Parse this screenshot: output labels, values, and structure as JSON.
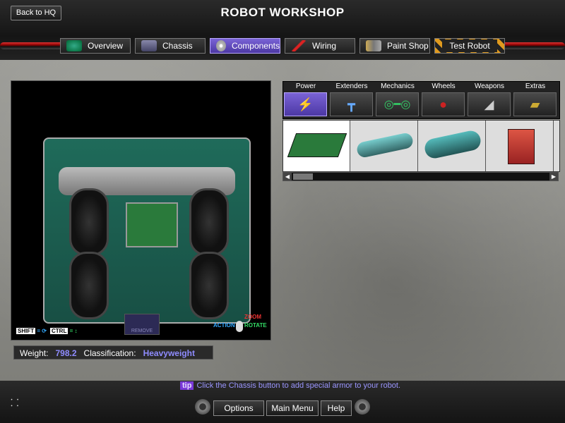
{
  "header": {
    "title": "ROBOT WORKSHOP",
    "back_label": "Back to HQ"
  },
  "tabs": [
    {
      "label": "Overview",
      "icon": "globe-icon"
    },
    {
      "label": "Chassis",
      "icon": "chassis-icon"
    },
    {
      "label": "Components",
      "icon": "gear-icon",
      "active": true
    },
    {
      "label": "Wiring",
      "icon": "wire-icon"
    },
    {
      "label": "Paint Shop",
      "icon": "paint-icon"
    },
    {
      "label": "Test Robot",
      "icon": "hazard-icon"
    }
  ],
  "viewport": {
    "shift_hint": "SHIFT",
    "ctrl_hint": "CTRL",
    "remove_label": "REMOVE",
    "action_label": "ACTION",
    "zoom_label": "ZOOM",
    "rotate_label": "ROTATE"
  },
  "stats": {
    "weight_label": "Weight:",
    "weight_value": "798.2",
    "class_label": "Classification:",
    "class_value": "Heavyweight"
  },
  "categories": [
    {
      "label": "Power",
      "icon": "lightning-icon",
      "active": true
    },
    {
      "label": "Extenders",
      "icon": "extender-icon"
    },
    {
      "label": "Mechanics",
      "icon": "chain-icon"
    },
    {
      "label": "Wheels",
      "icon": "wheel-icon"
    },
    {
      "label": "Weapons",
      "icon": "blade-icon"
    },
    {
      "label": "Extras",
      "icon": "extras-icon"
    }
  ],
  "parts": [
    {
      "icon": "circuit-board-icon",
      "selected": true
    },
    {
      "icon": "tank-icon"
    },
    {
      "icon": "co2-tank-icon"
    },
    {
      "icon": "battery-box-icon"
    }
  ],
  "tip": {
    "badge": "tip",
    "text": "Click the Chassis button to add special armor to your robot."
  },
  "footer": {
    "options": "Options",
    "main_menu": "Main Menu",
    "help": "Help"
  }
}
